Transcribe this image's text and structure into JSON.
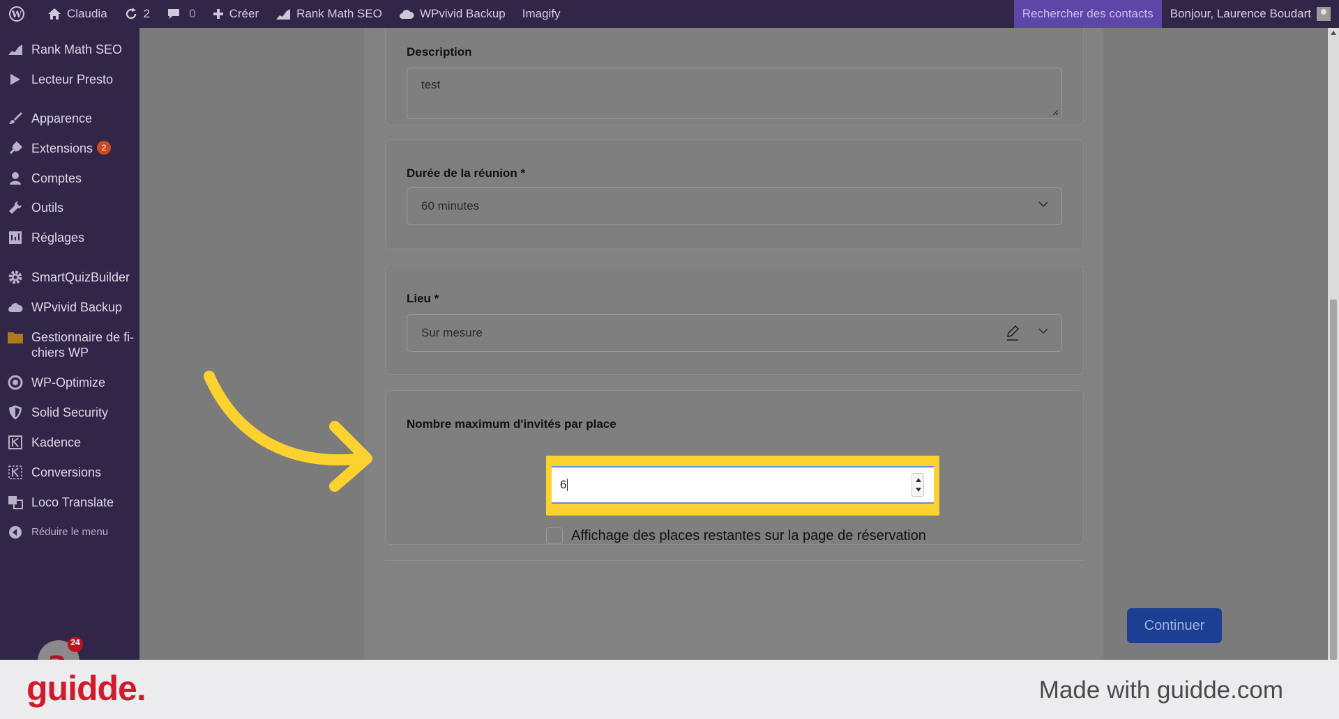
{
  "admin_bar": {
    "site_name": "Claudia",
    "updates_count": "2",
    "comments_count": "0",
    "create_label": "Créer",
    "rankmath_label": "Rank Math SEO",
    "wpvivid_label": "WPvivid Backup",
    "imagify_label": "Imagify",
    "search_contacts_label": "Rechercher des contacts",
    "greeting": "Bonjour, Laurence Boudart"
  },
  "sidebar": {
    "items": [
      {
        "label": "Rank Math SEO",
        "icon": "chart-icon"
      },
      {
        "label": "Lecteur Presto",
        "icon": "play-icon"
      },
      {
        "label": "Apparence",
        "icon": "brush-icon"
      },
      {
        "label": "Extensions",
        "icon": "plug-icon",
        "badge": "2"
      },
      {
        "label": "Comptes",
        "icon": "user-icon"
      },
      {
        "label": "Outils",
        "icon": "wrench-icon"
      },
      {
        "label": "Réglages",
        "icon": "settings-icon"
      },
      {
        "label": "SmartQuizBuilder",
        "icon": "gear-icon"
      },
      {
        "label": "WPvivid Backup",
        "icon": "cloud-icon"
      },
      {
        "label": "Gestionnaire de fi-\nchiers WP",
        "label_line1": "Gestionnaire de fi-",
        "label_line2": "chiers WP",
        "icon": "folder-icon"
      },
      {
        "label": "WP-Optimize",
        "icon": "optimize-icon"
      },
      {
        "label": "Solid Security",
        "icon": "shield-icon"
      },
      {
        "label": "Kadence",
        "icon": "kadence-icon"
      },
      {
        "label": "Conversions",
        "icon": "conversions-icon"
      },
      {
        "label": "Loco Translate",
        "icon": "translate-icon"
      },
      {
        "label": "Réduire le menu",
        "icon": "collapse-icon"
      }
    ],
    "notification_count": "24"
  },
  "form": {
    "description_label": "Description",
    "description_value": "test",
    "duration_label": "Durée de la réunion *",
    "duration_value": "60 minutes",
    "location_label": "Lieu *",
    "location_value": "Sur mesure",
    "max_guests_label": "Nombre maximum d'invités par place",
    "max_guests_value": "6",
    "show_remaining_label": "Affichage des places restantes sur la page de réservation",
    "continue_label": "Continuer"
  },
  "footer": {
    "logo": "guidde.",
    "made_with": "Made with guidde.com"
  },
  "colors": {
    "admin_bar": "#322648",
    "accent_highlight": "#fdd22e",
    "continue_button": "#1c3f93",
    "logo_red": "#d11a2a"
  }
}
